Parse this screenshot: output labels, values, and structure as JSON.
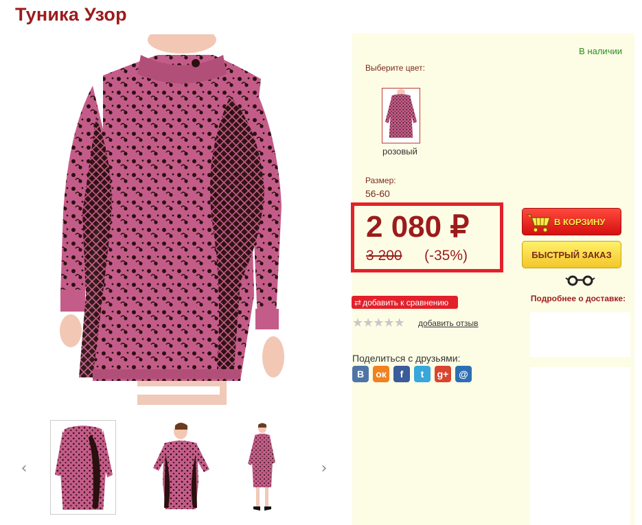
{
  "product": {
    "title": "Туника Узор"
  },
  "availability": "В наличии",
  "color": {
    "label": "Выберите цвет:",
    "selected": "розовый"
  },
  "size": {
    "label": "Размер:",
    "value": "56-60"
  },
  "price": {
    "current": "2 080 ₽",
    "old": "3 200",
    "discount": "(-35%)"
  },
  "buttons": {
    "cart": "В КОРЗИНУ",
    "quick_order": "БЫСТРЫЙ ЗАКАЗ",
    "compare": "добавить к сравнению"
  },
  "delivery": {
    "text": "Подробнее о доставке:"
  },
  "reviews": {
    "rating": 0,
    "max": 5,
    "link": "добавить отзыв"
  },
  "share": {
    "label": "Поделиться с друзьями:",
    "networks": [
      {
        "name": "vkontakte",
        "glyph": "В",
        "color": "#4f75a6"
      },
      {
        "name": "odnoklassniki",
        "glyph": "ок",
        "color": "#f0821f"
      },
      {
        "name": "facebook",
        "glyph": "f",
        "color": "#3b5b99"
      },
      {
        "name": "twitter",
        "glyph": "t",
        "color": "#37a7dc"
      },
      {
        "name": "google-plus",
        "glyph": "g+",
        "color": "#d9452e"
      },
      {
        "name": "mail-ru",
        "glyph": "@",
        "color": "#2e6fb3"
      }
    ]
  },
  "gallery": {
    "prev_glyph": "‹",
    "next_glyph": "›"
  },
  "colors": {
    "title": "#9c1b1b",
    "accent_red": "#e3212b",
    "panel_bg": "#fdfde6",
    "in_stock": "#2d8a1e",
    "dress_pink": "#c45c89",
    "dress_black": "#2b1010"
  }
}
